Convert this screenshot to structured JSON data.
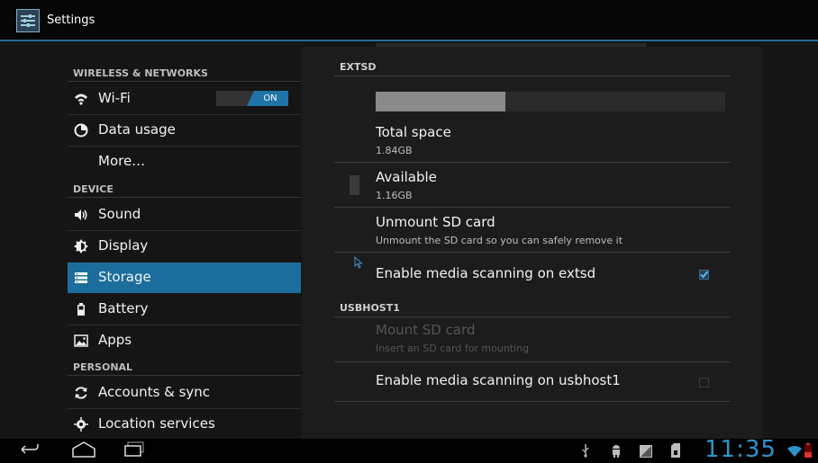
{
  "app": {
    "title": "Settings",
    "icon": "settings-sliders-icon"
  },
  "sidebar": {
    "sections": [
      {
        "header": "WIRELESS & NETWORKS"
      },
      {
        "header": "DEVICE"
      },
      {
        "header": "PERSONAL"
      }
    ],
    "items": [
      {
        "label": "Wi-Fi",
        "icon": "wifi-icon",
        "toggle": "ON"
      },
      {
        "label": "Data usage",
        "icon": "data-usage-icon"
      },
      {
        "label": "More…"
      },
      {
        "label": "Sound",
        "icon": "sound-icon"
      },
      {
        "label": "Display",
        "icon": "display-icon"
      },
      {
        "label": "Storage",
        "icon": "storage-icon",
        "selected": true
      },
      {
        "label": "Battery",
        "icon": "battery-icon"
      },
      {
        "label": "Apps",
        "icon": "apps-icon"
      },
      {
        "label": "Accounts & sync",
        "icon": "sync-icon"
      },
      {
        "label": "Location services",
        "icon": "location-icon"
      }
    ]
  },
  "content": {
    "extsd": {
      "header": "EXTSD",
      "usage_fraction": 0.37,
      "total_label": "Total space",
      "total_value": "1.84GB",
      "available_label": "Available",
      "available_value": "1.16GB",
      "unmount_label": "Unmount SD card",
      "unmount_desc": "Unmount the SD card so you can safely remove it",
      "scan_label": "Enable media scanning on extsd",
      "scan_checked": true
    },
    "usbhost1": {
      "header": "USBHOST1",
      "mount_label": "Mount SD card",
      "mount_desc": "Insert an SD card for mounting",
      "scan_label": "Enable media scanning on usbhost1",
      "scan_checked": false
    }
  },
  "status_bar": {
    "time": "11:35",
    "icons": [
      "back-icon",
      "home-icon",
      "recent-apps-icon",
      "usb-icon",
      "android-debug-icon",
      "screenshot-icon",
      "sd-card-icon",
      "wifi-signal-icon",
      "battery-low-icon"
    ]
  },
  "colors": {
    "accent": "#1b6e9c",
    "clock": "#2d95c9"
  }
}
